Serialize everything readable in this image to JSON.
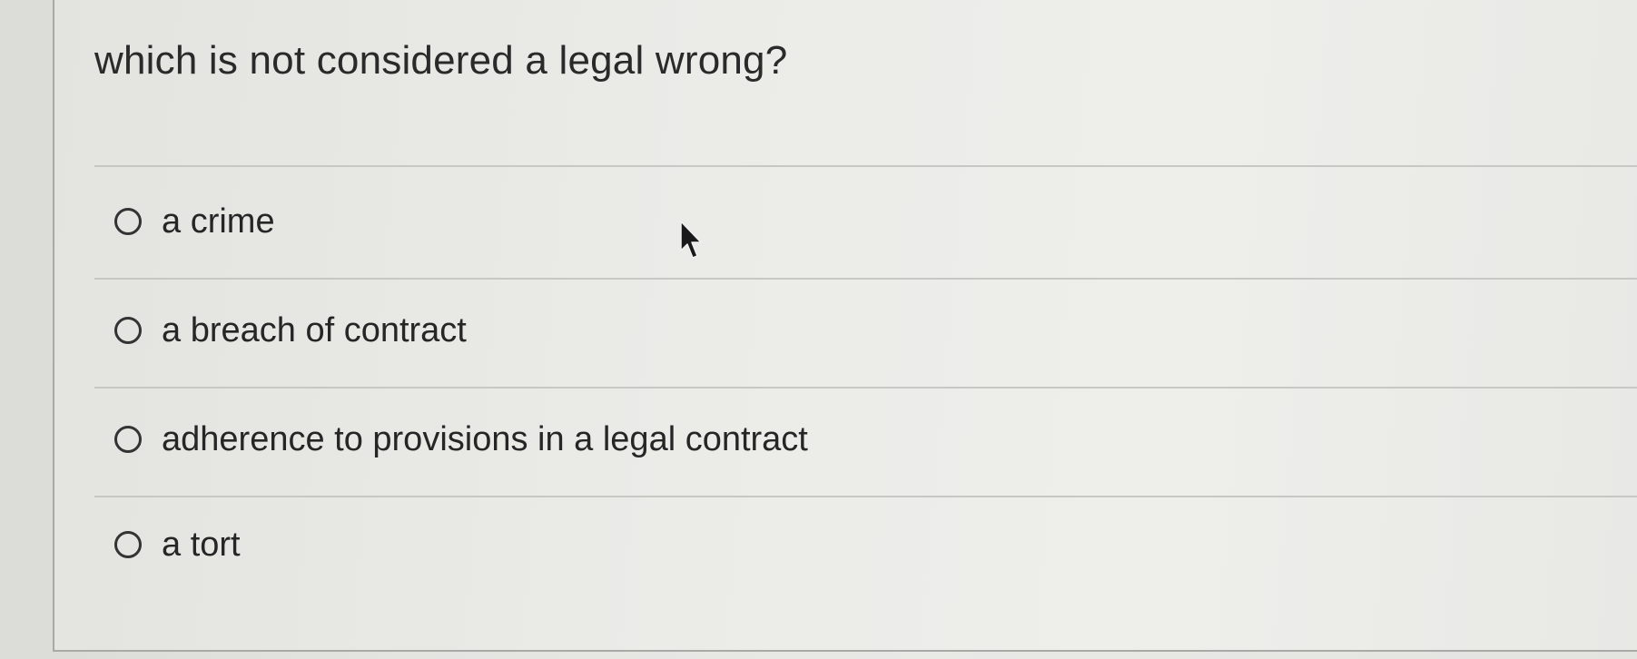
{
  "question": {
    "text": "which is not considered a legal wrong?"
  },
  "options": [
    {
      "label": "a crime",
      "selected": false
    },
    {
      "label": "a breach of contract",
      "selected": false
    },
    {
      "label": "adherence to provisions in a legal contract",
      "selected": false
    },
    {
      "label": "a tort",
      "selected": false
    }
  ],
  "icons": {
    "radio": "radio-unselected-icon",
    "cursor": "mouse-pointer-icon"
  },
  "colors": {
    "text": "#262626",
    "divider": "#c7c7c3",
    "background": "#eaeae7"
  }
}
